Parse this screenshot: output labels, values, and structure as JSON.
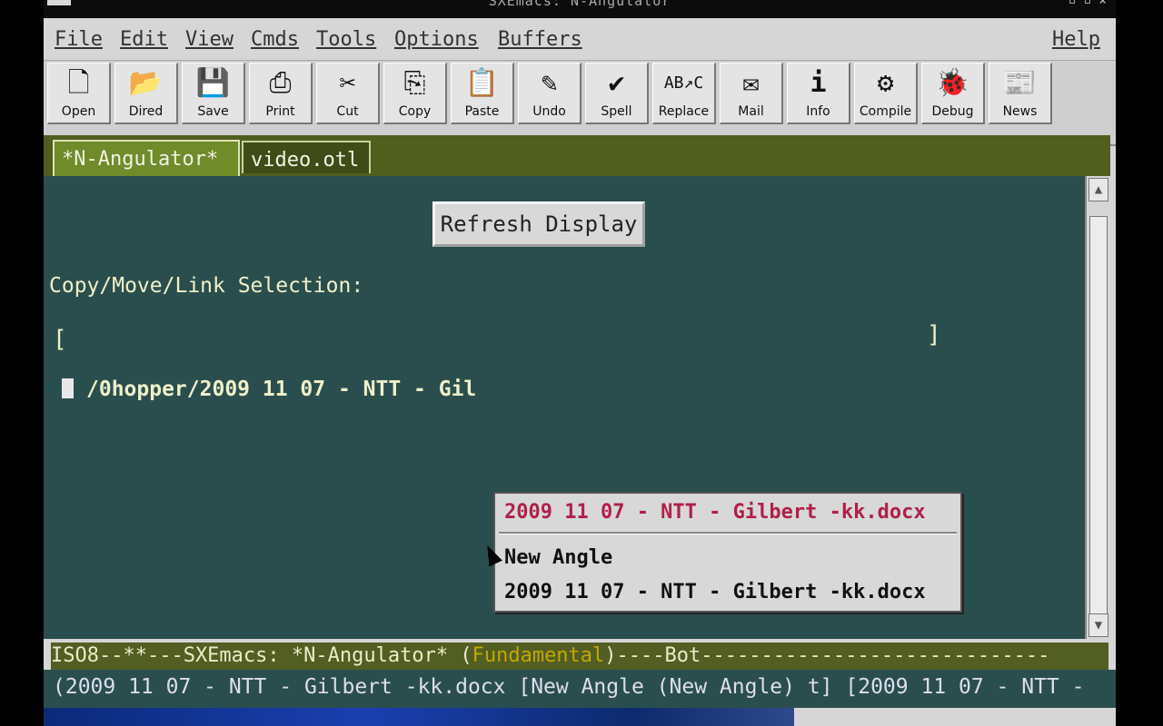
{
  "window": {
    "title": "SXEmacs: N-Angulator"
  },
  "menubar": {
    "items": [
      "File",
      "Edit",
      "View",
      "Cmds",
      "Tools",
      "Options",
      "Buffers"
    ],
    "help": "Help"
  },
  "toolbar": {
    "buttons": [
      {
        "label": "Open",
        "icon": "open-icon"
      },
      {
        "label": "Dired",
        "icon": "dired-icon"
      },
      {
        "label": "Save",
        "icon": "save-icon"
      },
      {
        "label": "Print",
        "icon": "print-icon"
      },
      {
        "label": "Cut",
        "icon": "cut-icon"
      },
      {
        "label": "Copy",
        "icon": "copy-icon"
      },
      {
        "label": "Paste",
        "icon": "paste-icon"
      },
      {
        "label": "Undo",
        "icon": "undo-icon"
      },
      {
        "label": "Spell",
        "icon": "spell-icon"
      },
      {
        "label": "Replace",
        "icon": "replace-icon"
      },
      {
        "label": "Mail",
        "icon": "mail-icon"
      },
      {
        "label": "Info",
        "icon": "info-icon"
      },
      {
        "label": "Compile",
        "icon": "compile-icon"
      },
      {
        "label": "Debug",
        "icon": "debug-icon"
      },
      {
        "label": "News",
        "icon": "news-icon"
      }
    ]
  },
  "tabs": [
    "*N-Angulator*",
    "video.otl"
  ],
  "buffer": {
    "refresh_button": "Refresh Display",
    "prompt": "Copy/Move/Link Selection:",
    "bracket_open": "[",
    "bracket_close": "]",
    "path": "/0hopper/2009 11 07 - NTT - Gil"
  },
  "popup": {
    "title": "2009 11 07 - NTT - Gilbert -kk.docx",
    "items": [
      "New Angle",
      "2009 11 07 - NTT - Gilbert -kk.docx"
    ]
  },
  "modeline": {
    "prefix": "ISO8--**---SXEmacs: *N-Angulator*  (",
    "mode": "Fundamental",
    "suffix": ")----Bot-----------------------------"
  },
  "echo_area": "(2009 11 07 - NTT - Gilbert -kk.docx [New Angle (New Angle) t] [2009 11 07 - NTT -"
}
